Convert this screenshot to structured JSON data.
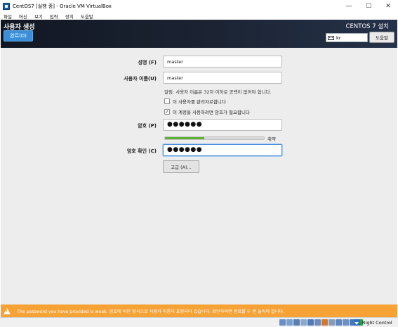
{
  "window": {
    "title": "CentOS7 [실행 중] - Oracle VM VirtualBox",
    "minimize": "—",
    "maximize": "☐",
    "close": "✕"
  },
  "menubar": [
    "파일",
    "머신",
    "보기",
    "입력",
    "장치",
    "도움말"
  ],
  "header": {
    "page_title": "사용자 생성",
    "done_label": "완료(D)",
    "product_title": "CENTOS 7 설치",
    "keyboard_layout": "kr",
    "help_label": "도움말"
  },
  "form": {
    "fullname_label": "성명 (F)",
    "fullname_value": "master",
    "username_label": "사용자 이름(U)",
    "username_value": "master",
    "hint": "알림: 사용자 이름은 32자 이하로 공백이 없어야 합니다.",
    "admin_checkbox_label": "이 사용자를 관리자로합니다",
    "admin_checked": false,
    "require_password_label": "이 계정을 사용하려면 암호가 필요합니다",
    "require_password_checked": true,
    "password_label": "암호 (P)",
    "password_value": "●●●●●●",
    "strength_fraction": 0.4,
    "strength_label": "취약",
    "confirm_label": "암호 확인 (C)",
    "confirm_value": "●●●●●●",
    "advanced_label": "고급 (A)..."
  },
  "warning": {
    "text": "The password you have provided is weak: 암호에 어떤 형식으로 사용자 이름이 포함되어 있습니다. 확인하려면 완료를 두 번 눌러야 합니다."
  },
  "statusbar": {
    "right_control": "Right Control",
    "icon_colors": [
      "#6a8fc0",
      "#7aa0d0",
      "#5a7fb0",
      "#8aa8cc",
      "#4f7cb8",
      "#6c8cbf",
      "#d07a30",
      "#8a9bb8",
      "#5b87c4",
      "#6e90c2",
      "#4a78b5",
      "#2d9c4a"
    ]
  },
  "colors": {
    "header_bg": "#1a1f2c",
    "done_button": "#3b8fd8",
    "warning_bg": "#f6a235",
    "strength_fill": "#5bb233"
  }
}
